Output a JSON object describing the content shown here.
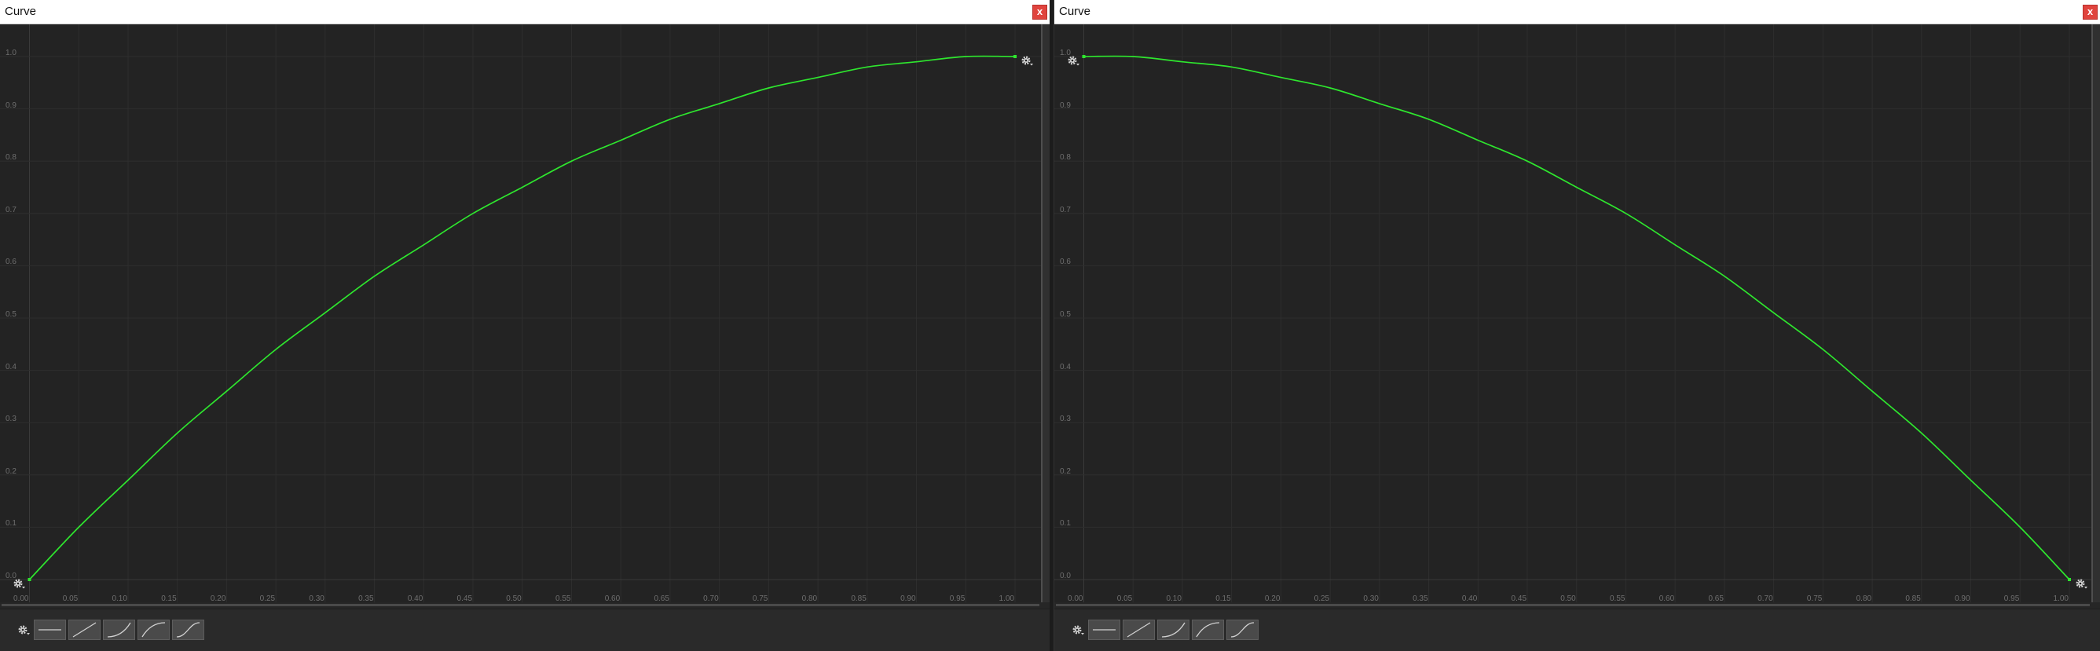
{
  "theme": {
    "close_button_color": "#e0443e",
    "curve_color": "#2ee62e"
  },
  "windows": [
    {
      "title": "Curve",
      "close_label": "x",
      "keyframe_icon": "gear-icon",
      "toolbar": {
        "settings_icon": "gear-icon",
        "presets": [
          {
            "icon": "flat-curve-icon"
          },
          {
            "icon": "linear-curve-icon"
          },
          {
            "icon": "ease-in-curve-icon"
          },
          {
            "icon": "ease-out-curve-icon"
          },
          {
            "icon": "ease-in-out-curve-icon"
          }
        ]
      }
    },
    {
      "title": "Curve",
      "close_label": "x",
      "keyframe_icon": "gear-icon",
      "toolbar": {
        "settings_icon": "gear-icon",
        "presets": [
          {
            "icon": "flat-curve-icon"
          },
          {
            "icon": "linear-curve-icon"
          },
          {
            "icon": "ease-in-curve-icon"
          },
          {
            "icon": "ease-out-curve-icon"
          },
          {
            "icon": "ease-in-out-curve-icon"
          }
        ]
      }
    }
  ],
  "chart_data": [
    {
      "type": "line",
      "x_ticks": [
        "0.00",
        "0.05",
        "0.10",
        "0.15",
        "0.20",
        "0.25",
        "0.30",
        "0.35",
        "0.40",
        "0.45",
        "0.50",
        "0.55",
        "0.60",
        "0.65",
        "0.70",
        "0.75",
        "0.80",
        "0.85",
        "0.90",
        "0.95",
        "1.00"
      ],
      "y_ticks": [
        "0.0",
        "0.1",
        "0.2",
        "0.3",
        "0.4",
        "0.5",
        "0.6",
        "0.7",
        "0.8",
        "0.9",
        "1.0"
      ],
      "xlim": [
        0,
        1
      ],
      "ylim": [
        0,
        1
      ],
      "grid": true,
      "line_color": "#2ee62e",
      "keyframes": [
        {
          "x": 0,
          "y": 0
        },
        {
          "x": 1,
          "y": 1
        }
      ],
      "x": [
        0,
        0.05,
        0.1,
        0.15,
        0.2,
        0.25,
        0.3,
        0.35,
        0.4,
        0.45,
        0.5,
        0.55,
        0.6,
        0.65,
        0.7,
        0.75,
        0.8,
        0.85,
        0.9,
        0.95,
        1
      ],
      "y": [
        0,
        0.1,
        0.19,
        0.28,
        0.36,
        0.44,
        0.51,
        0.58,
        0.64,
        0.7,
        0.75,
        0.8,
        0.84,
        0.88,
        0.91,
        0.94,
        0.96,
        0.98,
        0.99,
        1.0,
        1.0
      ]
    },
    {
      "type": "line",
      "x_ticks": [
        "0.00",
        "0.05",
        "0.10",
        "0.15",
        "0.20",
        "0.25",
        "0.30",
        "0.35",
        "0.40",
        "0.45",
        "0.50",
        "0.55",
        "0.60",
        "0.65",
        "0.70",
        "0.75",
        "0.80",
        "0.85",
        "0.90",
        "0.95",
        "1.00"
      ],
      "y_ticks": [
        "0.0",
        "0.1",
        "0.2",
        "0.3",
        "0.4",
        "0.5",
        "0.6",
        "0.7",
        "0.8",
        "0.9",
        "1.0"
      ],
      "xlim": [
        0,
        1
      ],
      "ylim": [
        0,
        1
      ],
      "grid": true,
      "line_color": "#2ee62e",
      "keyframes": [
        {
          "x": 0,
          "y": 1
        },
        {
          "x": 1,
          "y": 0
        }
      ],
      "x": [
        0,
        0.05,
        0.1,
        0.15,
        0.2,
        0.25,
        0.3,
        0.35,
        0.4,
        0.45,
        0.5,
        0.55,
        0.6,
        0.65,
        0.7,
        0.75,
        0.8,
        0.85,
        0.9,
        0.95,
        1
      ],
      "y": [
        1.0,
        1.0,
        0.99,
        0.98,
        0.96,
        0.94,
        0.91,
        0.88,
        0.84,
        0.8,
        0.75,
        0.7,
        0.64,
        0.58,
        0.51,
        0.44,
        0.36,
        0.28,
        0.19,
        0.1,
        0.0
      ]
    }
  ]
}
